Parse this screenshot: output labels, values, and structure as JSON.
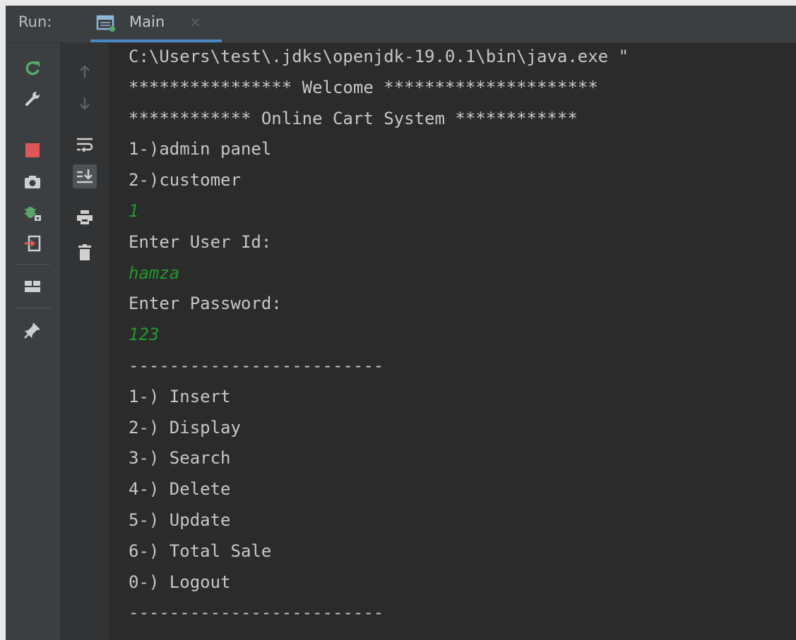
{
  "header": {
    "run_label": "Run:",
    "tab": {
      "label": "Main",
      "close": "×",
      "icon": "console-window-icon"
    }
  },
  "toolbar_left": [
    "rerun-icon",
    "wrench-icon",
    "stop-icon",
    "camera-icon",
    "debug-bug-icon",
    "exit-icon",
    "layout-icon",
    "pin-icon"
  ],
  "toolbar_right": [
    "arrow-up-icon",
    "arrow-down-icon",
    "soft-wrap-icon",
    "scroll-to-end-icon",
    "print-icon",
    "trash-icon"
  ],
  "console": {
    "lines": [
      {
        "text": "C:\\Users\\test\\.jdks\\openjdk-19.0.1\\bin\\java.exe \"",
        "type": "output"
      },
      {
        "text": "**************** Welcome *********************",
        "type": "output"
      },
      {
        "text": "************ Online Cart System ************",
        "type": "output"
      },
      {
        "text": "1-)admin panel",
        "type": "output"
      },
      {
        "text": "2-)customer",
        "type": "output"
      },
      {
        "text": "1",
        "type": "input"
      },
      {
        "text": "Enter User Id:",
        "type": "output"
      },
      {
        "text": "hamza",
        "type": "input"
      },
      {
        "text": "Enter Password:",
        "type": "output"
      },
      {
        "text": "123",
        "type": "input"
      },
      {
        "text": "-------------------------",
        "type": "output"
      },
      {
        "text": "1-) Insert",
        "type": "output"
      },
      {
        "text": "2-) Display",
        "type": "output"
      },
      {
        "text": "3-) Search",
        "type": "output"
      },
      {
        "text": "4-) Delete",
        "type": "output"
      },
      {
        "text": "5-) Update",
        "type": "output"
      },
      {
        "text": "6-) Total Sale",
        "type": "output"
      },
      {
        "text": "0-) Logout",
        "type": "output"
      },
      {
        "text": "-------------------------",
        "type": "output"
      }
    ]
  },
  "colors": {
    "background": "#2b2b2b",
    "output_text": "#c7c7c7",
    "input_text": "#1f9a2d",
    "tab_underline": "#4a88c7",
    "stop": "#e05555",
    "rerun": "#59a869"
  }
}
